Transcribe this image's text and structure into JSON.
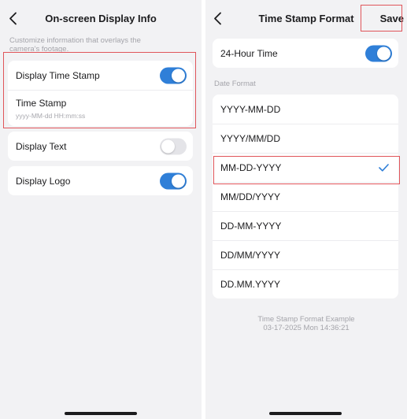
{
  "left": {
    "title": "On-screen Display Info",
    "hint": "Customize information that overlays the camera's footage.",
    "display_time_stamp": {
      "label": "Display Time Stamp",
      "on": true
    },
    "time_stamp": {
      "label": "Time Stamp",
      "value": "yyyy-MM-dd HH:mm:ss"
    },
    "display_text": {
      "label": "Display Text",
      "on": false
    },
    "display_logo": {
      "label": "Display Logo",
      "on": true
    }
  },
  "right": {
    "title": "Time Stamp Format",
    "save_label": "Save",
    "hour_24": {
      "label": "24-Hour Time",
      "on": true
    },
    "date_format_label": "Date Format",
    "formats": [
      "YYYY-MM-DD",
      "YYYY/MM/DD",
      "MM-DD-YYYY",
      "MM/DD/YYYY",
      "DD-MM-YYYY",
      "DD/MM/YYYY",
      "DD.MM.YYYY"
    ],
    "selected_format": "MM-DD-YYYY",
    "example_label": "Time Stamp Format Example",
    "example_value": "03-17-2025 Mon 14:36:21"
  },
  "colors": {
    "accent": "#2f7fd8",
    "highlight": "#e0555a",
    "toggle_off": "#e4e4e8"
  },
  "icons": [
    "chevron-left-icon",
    "checkmark-icon"
  ]
}
